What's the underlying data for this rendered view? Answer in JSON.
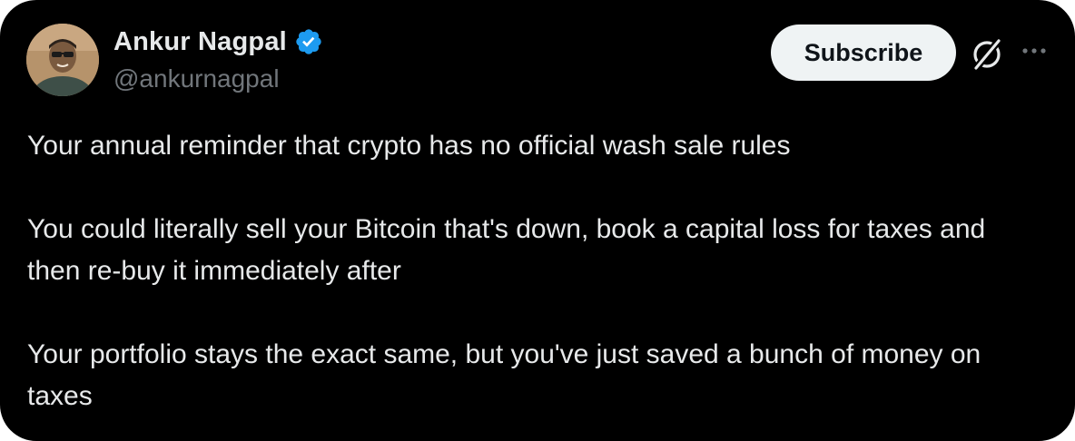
{
  "author": {
    "display_name": "Ankur Nagpal",
    "handle": "@ankurnagpal",
    "verified": true,
    "verified_color": "#1d9bf0"
  },
  "actions": {
    "subscribe_label": "Subscribe"
  },
  "icons": {
    "verified": "verified-badge-icon",
    "grok": "grok-icon",
    "more": "more-options-icon"
  },
  "tweet": {
    "paragraphs": [
      "Your annual reminder that crypto has no official wash sale rules",
      "You could literally sell your Bitcoin that's down, book a capital loss for taxes and then re-buy it immediately after",
      "Your portfolio stays the exact same, but you've just saved a bunch of money on taxes"
    ]
  },
  "colors": {
    "background": "#000000",
    "text_primary": "#e7e9ea",
    "text_secondary": "#71767b",
    "button_bg": "#eff3f4",
    "button_text": "#0f1419"
  }
}
